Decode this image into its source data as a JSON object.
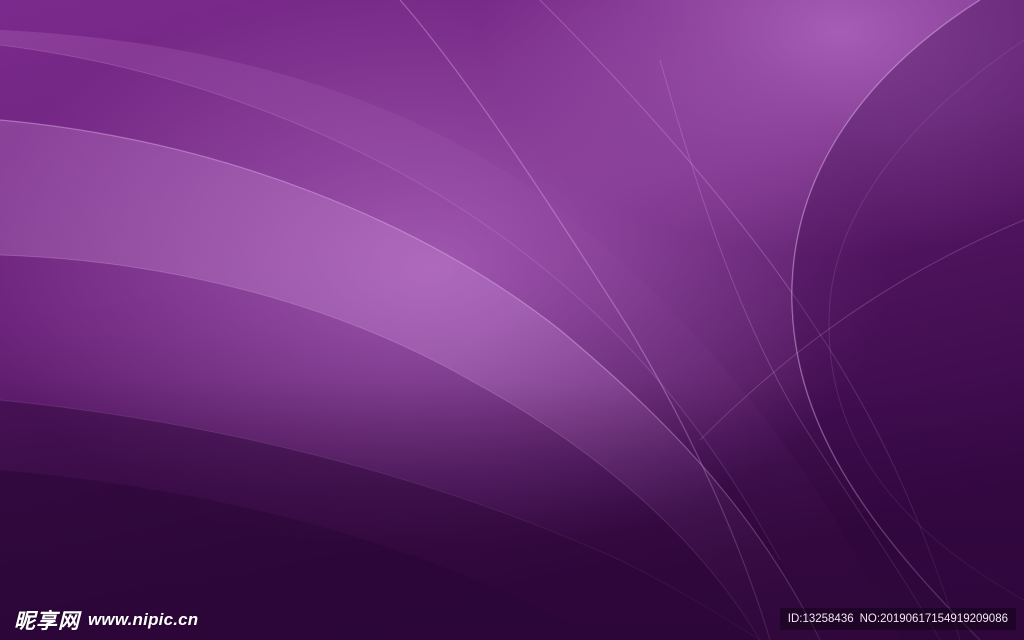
{
  "colors": {
    "base_dark": "#3a0f47",
    "base_mid": "#6e2480",
    "base_light": "#a35bb3",
    "highlight": "#c98ad6"
  },
  "watermark": {
    "brand": "昵享网",
    "site": "www.nipic.cn",
    "id_label": "ID:13258436",
    "no_label": "NO:20190617154919209086"
  }
}
